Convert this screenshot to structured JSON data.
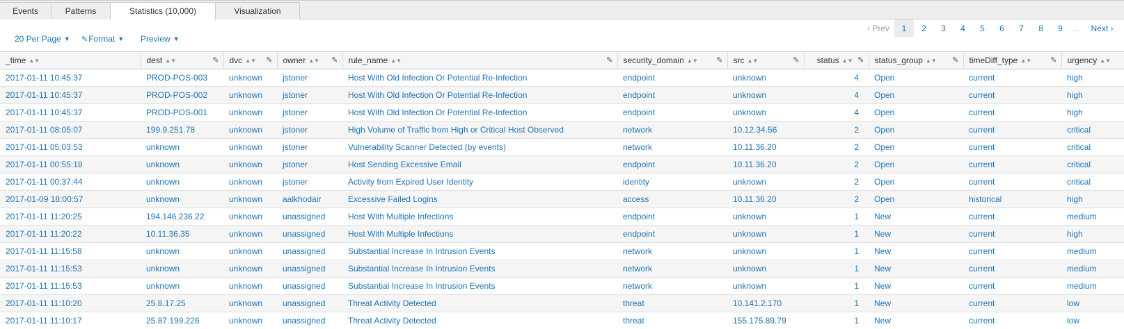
{
  "tabs": [
    {
      "label": "Events",
      "active": false
    },
    {
      "label": "Patterns",
      "active": false
    },
    {
      "label": "Statistics (10,000)",
      "active": true
    },
    {
      "label": "Visualization",
      "active": false
    }
  ],
  "toolbar": {
    "per_page_label": "20 Per Page",
    "format_label": "Format",
    "preview_label": "Preview"
  },
  "pagination": {
    "prev_label": "Prev",
    "next_label": "Next",
    "pages": [
      "1",
      "2",
      "3",
      "4",
      "5",
      "6",
      "7",
      "8",
      "9"
    ],
    "current": "1",
    "ellipsis": "..."
  },
  "colors": {
    "link": "#1e73b5",
    "header_bg": "#f5f5f5",
    "row_alt": "#f5f5f5",
    "tab_bg": "#eeeeee"
  },
  "columns": [
    "_time",
    "dest",
    "dvc",
    "owner",
    "rule_name",
    "security_domain",
    "src",
    "status",
    "status_group",
    "timeDiff_type",
    "urgency"
  ],
  "rows": [
    [
      "2017-01-11 10:45:37",
      "PROD-POS-003",
      "unknown",
      "jstoner",
      "Host With Old Infection Or Potential Re-Infection",
      "endpoint",
      "unknown",
      "4",
      "Open",
      "current",
      "high"
    ],
    [
      "2017-01-11 10:45:37",
      "PROD-POS-002",
      "unknown",
      "jstoner",
      "Host With Old Infection Or Potential Re-Infection",
      "endpoint",
      "unknown",
      "4",
      "Open",
      "current",
      "high"
    ],
    [
      "2017-01-11 10:45:37",
      "PROD-POS-001",
      "unknown",
      "jstoner",
      "Host With Old Infection Or Potential Re-Infection",
      "endpoint",
      "unknown",
      "4",
      "Open",
      "current",
      "high"
    ],
    [
      "2017-01-11 08:05:07",
      "199.9.251.78",
      "unknown",
      "jstoner",
      "High Volume of Traffic from High or Critical Host Observed",
      "network",
      "10.12.34.56",
      "2",
      "Open",
      "current",
      "critical"
    ],
    [
      "2017-01-11 05:03:53",
      "unknown",
      "unknown",
      "jstoner",
      "Vulnerability Scanner Detected (by events)",
      "network",
      "10.11.36.20",
      "2",
      "Open",
      "current",
      "critical"
    ],
    [
      "2017-01-11 00:55:18",
      "unknown",
      "unknown",
      "jstoner",
      "Host Sending Excessive Email",
      "endpoint",
      "10.11.36.20",
      "2",
      "Open",
      "current",
      "critical"
    ],
    [
      "2017-01-11 00:37:44",
      "unknown",
      "unknown",
      "jstoner",
      "Activity from Expired User Identity",
      "identity",
      "unknown",
      "2",
      "Open",
      "current",
      "critical"
    ],
    [
      "2017-01-09 18:00:57",
      "unknown",
      "unknown",
      "aalkhodair",
      "Excessive Failed Logins",
      "access",
      "10.11.36.20",
      "2",
      "Open",
      "historical",
      "high"
    ],
    [
      "2017-01-11 11:20:25",
      "194.146.236.22",
      "unknown",
      "unassigned",
      "Host With Multiple Infections",
      "endpoint",
      "unknown",
      "1",
      "New",
      "current",
      "medium"
    ],
    [
      "2017-01-11 11:20:22",
      "10.11.36.35",
      "unknown",
      "unassigned",
      "Host With Multiple Infections",
      "endpoint",
      "unknown",
      "1",
      "New",
      "current",
      "high"
    ],
    [
      "2017-01-11 11:15:58",
      "unknown",
      "unknown",
      "unassigned",
      "Substantial Increase In Intrusion Events",
      "network",
      "unknown",
      "1",
      "New",
      "current",
      "medium"
    ],
    [
      "2017-01-11 11:15:53",
      "unknown",
      "unknown",
      "unassigned",
      "Substantial Increase In Intrusion Events",
      "network",
      "unknown",
      "1",
      "New",
      "current",
      "medium"
    ],
    [
      "2017-01-11 11:15:53",
      "unknown",
      "unknown",
      "unassigned",
      "Substantial Increase In Intrusion Events",
      "network",
      "unknown",
      "1",
      "New",
      "current",
      "medium"
    ],
    [
      "2017-01-11 11:10:20",
      "25.8.17.25",
      "unknown",
      "unassigned",
      "Threat Activity Detected",
      "threat",
      "10.141.2.170",
      "1",
      "New",
      "current",
      "low"
    ],
    [
      "2017-01-11 11:10:17",
      "25.87.199.226",
      "unknown",
      "unassigned",
      "Threat Activity Detected",
      "threat",
      "155.175.89.79",
      "1",
      "New",
      "current",
      "low"
    ]
  ]
}
